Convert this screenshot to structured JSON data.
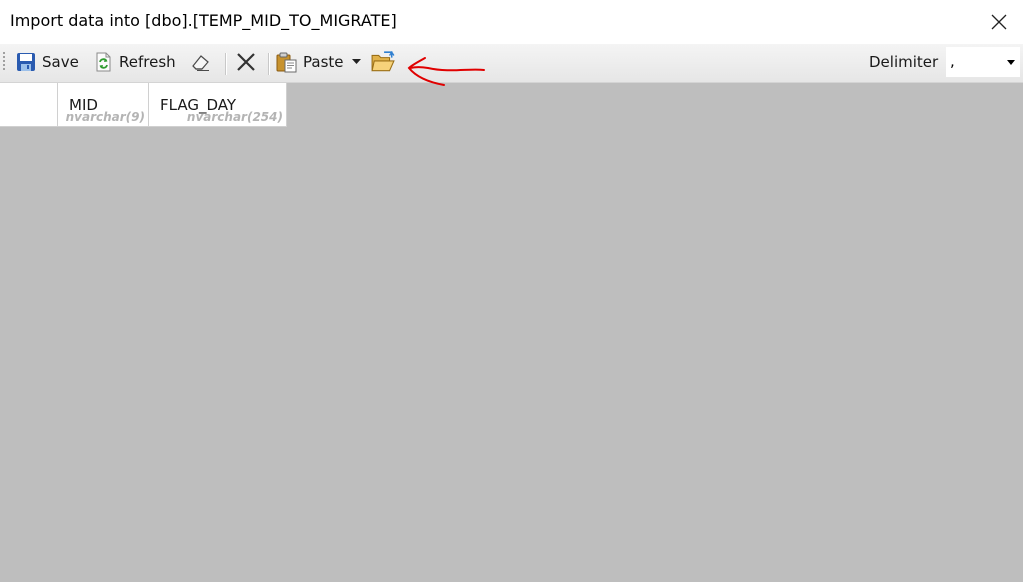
{
  "window": {
    "title": "Import data into [dbo].[TEMP_MID_TO_MIGRATE]"
  },
  "toolbar": {
    "save_label": "Save",
    "refresh_label": "Refresh",
    "paste_label": "Paste",
    "delimiter_label": "Delimiter",
    "delimiter_value": ","
  },
  "grid": {
    "columns": [
      {
        "name": "MID",
        "type": "nvarchar(9)"
      },
      {
        "name": "FLAG_DAY",
        "type": "nvarchar(254)"
      }
    ]
  },
  "colors": {
    "grid_background": "#bebebe",
    "annotation": "#e00000"
  }
}
